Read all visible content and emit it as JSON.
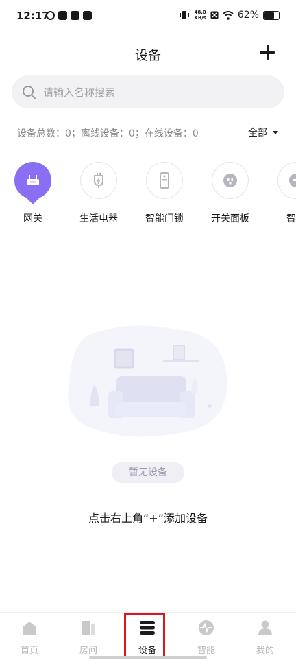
{
  "status_bar": {
    "time": "12:17",
    "net_speed_value": "48.0",
    "net_speed_unit": "KB/s",
    "battery": "62%"
  },
  "header": {
    "title": "设备",
    "add_icon": "plus-icon"
  },
  "search": {
    "placeholder": "请输入名称搜索",
    "icon": "search-icon"
  },
  "stats": {
    "text": "设备总数：0；离线设备：0；在线设备：0",
    "filter_label": "全部"
  },
  "categories": [
    {
      "label": "网关",
      "icon": "gateway-icon",
      "active": true
    },
    {
      "label": "生活电器",
      "icon": "plug-icon",
      "active": false
    },
    {
      "label": "智能门锁",
      "icon": "door-lock-icon",
      "active": false
    },
    {
      "label": "开关面板",
      "icon": "switch-panel-icon",
      "active": false
    },
    {
      "label": "智能",
      "icon": "smart-device-icon",
      "active": false
    }
  ],
  "empty_state": {
    "badge": "暂无设备",
    "hint": "点击右上角“+”添加设备"
  },
  "tabbar": {
    "items": [
      {
        "label": "首页",
        "icon": "home-icon",
        "active": false
      },
      {
        "label": "房间",
        "icon": "room-icon",
        "active": false
      },
      {
        "label": "设备",
        "icon": "device-icon",
        "active": true
      },
      {
        "label": "智能",
        "icon": "activity-icon",
        "active": false
      },
      {
        "label": "我的",
        "icon": "user-icon",
        "active": false
      }
    ]
  },
  "colors": {
    "accent": "#8b6ff2",
    "highlight_box": "#e0141c",
    "inactive_tab": "#b7b7b7"
  }
}
